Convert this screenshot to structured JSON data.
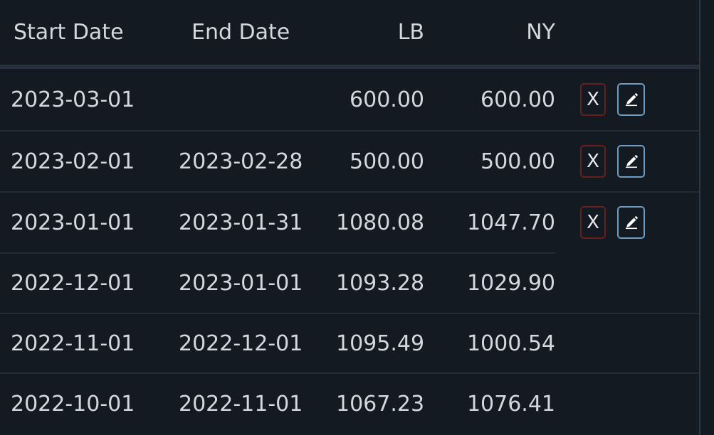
{
  "table": {
    "headers": {
      "start": "Start Date",
      "end": "End Date",
      "lb": "LB",
      "ny": "NY"
    },
    "rows": [
      {
        "start": "2023-03-01",
        "end": "",
        "lb": "600.00",
        "ny": "600.00",
        "actions": true
      },
      {
        "start": "2023-02-01",
        "end": "2023-02-28",
        "lb": "500.00",
        "ny": "500.00",
        "actions": true
      },
      {
        "start": "2023-01-01",
        "end": "2023-01-31",
        "lb": "1080.08",
        "ny": "1047.70",
        "actions": true
      },
      {
        "start": "2022-12-01",
        "end": "2023-01-01",
        "lb": "1093.28",
        "ny": "1029.90",
        "actions": false
      },
      {
        "start": "2022-11-01",
        "end": "2022-12-01",
        "lb": "1095.49",
        "ny": "1000.54",
        "actions": false
      },
      {
        "start": "2022-10-01",
        "end": "2022-11-01",
        "lb": "1067.23",
        "ny": "1076.41",
        "actions": false
      }
    ]
  },
  "actions": {
    "delete_label": "X",
    "delete_icon": "x-icon",
    "edit_icon": "pencil-icon"
  },
  "colors": {
    "background": "#131a22",
    "text": "#d3d8de",
    "delete_border": "#6b1f1c",
    "edit_border": "#6f9cc0"
  }
}
